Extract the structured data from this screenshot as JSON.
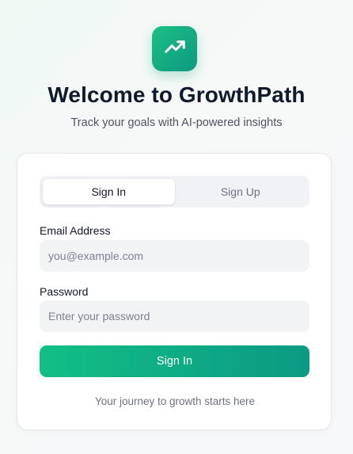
{
  "header": {
    "logo_icon": "trending-up-icon",
    "title": "Welcome to GrowthPath",
    "subtitle": "Track your goals with AI-powered insights"
  },
  "tabs": [
    {
      "label": "Sign In",
      "active": true
    },
    {
      "label": "Sign Up",
      "active": false
    }
  ],
  "form": {
    "email_label": "Email Address",
    "email_placeholder": "you@example.com",
    "email_value": "",
    "password_label": "Password",
    "password_placeholder": "Enter your password",
    "password_value": "",
    "submit_label": "Sign In"
  },
  "footer_text": "Your journey to growth starts here",
  "colors": {
    "accent_start": "#12bf85",
    "accent_end": "#0b9a83",
    "title": "#0f1b2d"
  }
}
